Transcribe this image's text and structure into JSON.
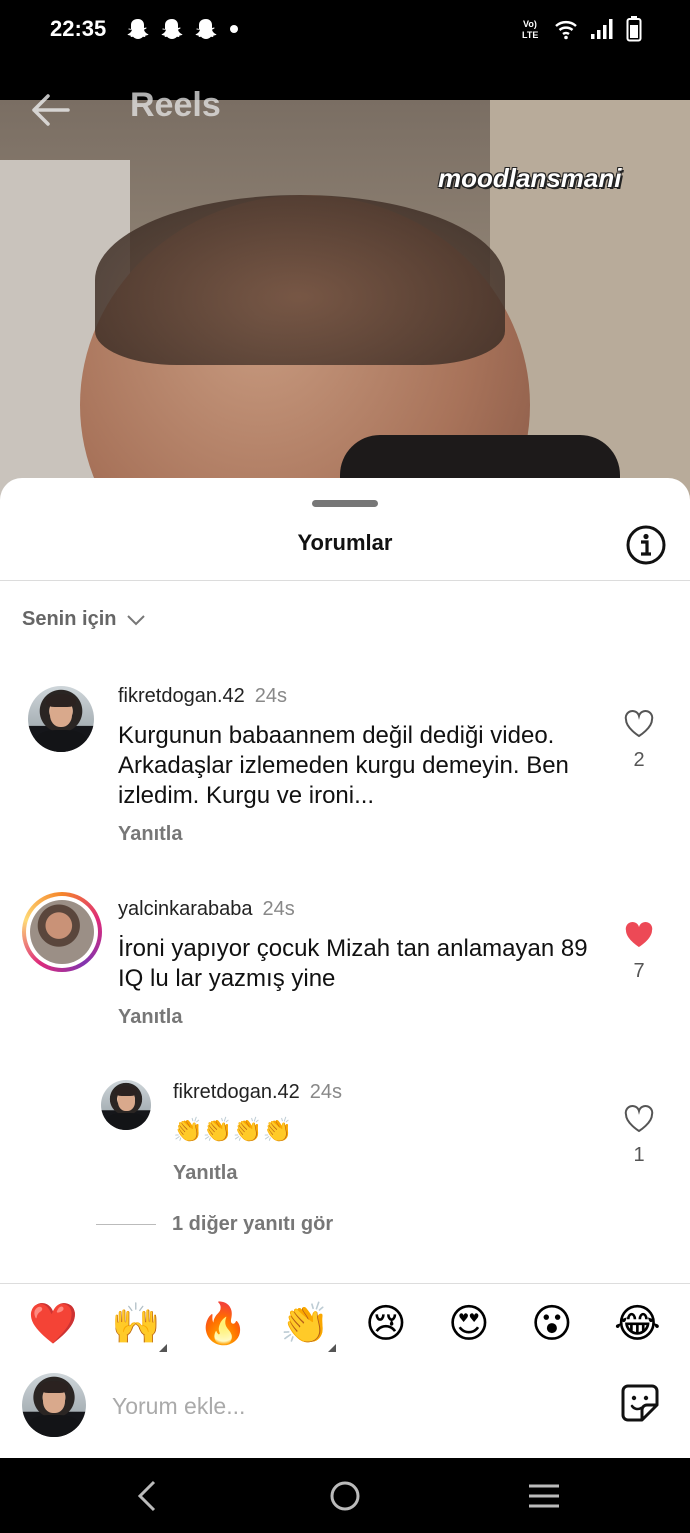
{
  "status_bar": {
    "time": "22:35",
    "notification_icons": [
      "snapchat-icon",
      "snapchat-icon",
      "snapchat-icon",
      "dot-icon"
    ],
    "right_icons": [
      "volte-icon",
      "wifi-icon",
      "signal-icon",
      "battery-icon"
    ]
  },
  "video": {
    "title": "Reels",
    "watermark": "moodlansmani"
  },
  "sheet": {
    "title": "Yorumlar",
    "filter_label": "Senin için"
  },
  "comments": [
    {
      "username": "fikretdogan.42",
      "time": "24s",
      "text": "Kurgunun babaannem değil dediği video. Arkadaşlar izlemeden kurgu demeyin. Ben izledim. Kurgu ve ironi...",
      "reply_label": "Yanıtla",
      "likes": "2",
      "liked": false
    },
    {
      "username": "yalcinkarababa",
      "time": "24s",
      "text": "İroni yapıyor çocuk Mizah tan anlamayan 89 IQ lu lar yazmış yine",
      "reply_label": "Yanıtla",
      "likes": "7",
      "liked": true
    },
    {
      "username": "fikretdogan.42",
      "time": "24s",
      "text": "👏👏👏👏",
      "reply_label": "Yanıtla",
      "likes": "1",
      "liked": false
    }
  ],
  "view_replies": "1 diğer yanıtı gör",
  "emoji_bar": [
    "❤️",
    "🙌",
    "🔥",
    "👏",
    "😢",
    "😍",
    "😮",
    "😂"
  ],
  "composer": {
    "placeholder": "Yorum ekle..."
  },
  "colors": {
    "like_red": "#ed4956",
    "text_primary": "#111111",
    "text_secondary": "#777777"
  }
}
